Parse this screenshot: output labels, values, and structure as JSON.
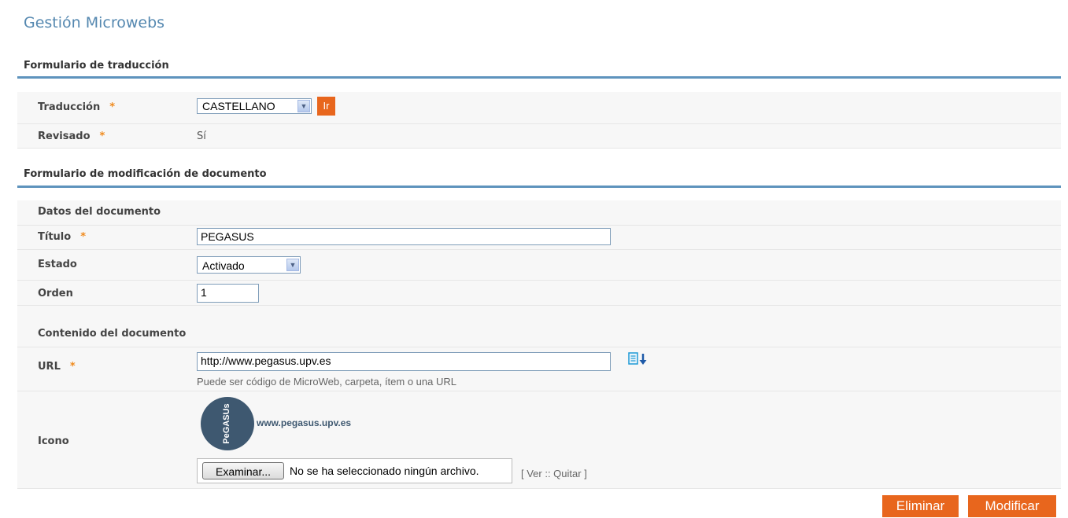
{
  "page_title": "Gestión Microwebs",
  "translation_form": {
    "header": "Formulario de traducción",
    "traduccion_label": "Traducción",
    "traduccion_value": "CASTELLANO",
    "ir_button": "Ir",
    "revisado_label": "Revisado",
    "revisado_value": "Sí",
    "required_mark": "*"
  },
  "document_form": {
    "header": "Formulario de modificación de documento",
    "datos_header": "Datos del documento",
    "titulo_label": "Título",
    "titulo_value": "PEGASUS",
    "estado_label": "Estado",
    "estado_value": "Activado",
    "orden_label": "Orden",
    "orden_value": "1",
    "contenido_header": "Contenido del documento",
    "url_label": "URL",
    "url_value": "http://www.pegasus.upv.es",
    "url_hint": "Puede ser código de MicroWeb, carpeta, ítem o una URL",
    "icono_label": "Icono",
    "icon_logo_text": "PeGASUs",
    "icon_site_text": "www.pegasus.upv.es",
    "browse_button": "Examinar...",
    "no_file_text": "No se ha seleccionado ningún archivo.",
    "ver_quitar": "[ Ver :: Quitar ]"
  },
  "actions": {
    "delete_label": "Eliminar",
    "modify_label": "Modificar"
  },
  "colors": {
    "accent_blue": "#5e93bd",
    "orange": "#e8661d",
    "required": "#f08a1c"
  }
}
